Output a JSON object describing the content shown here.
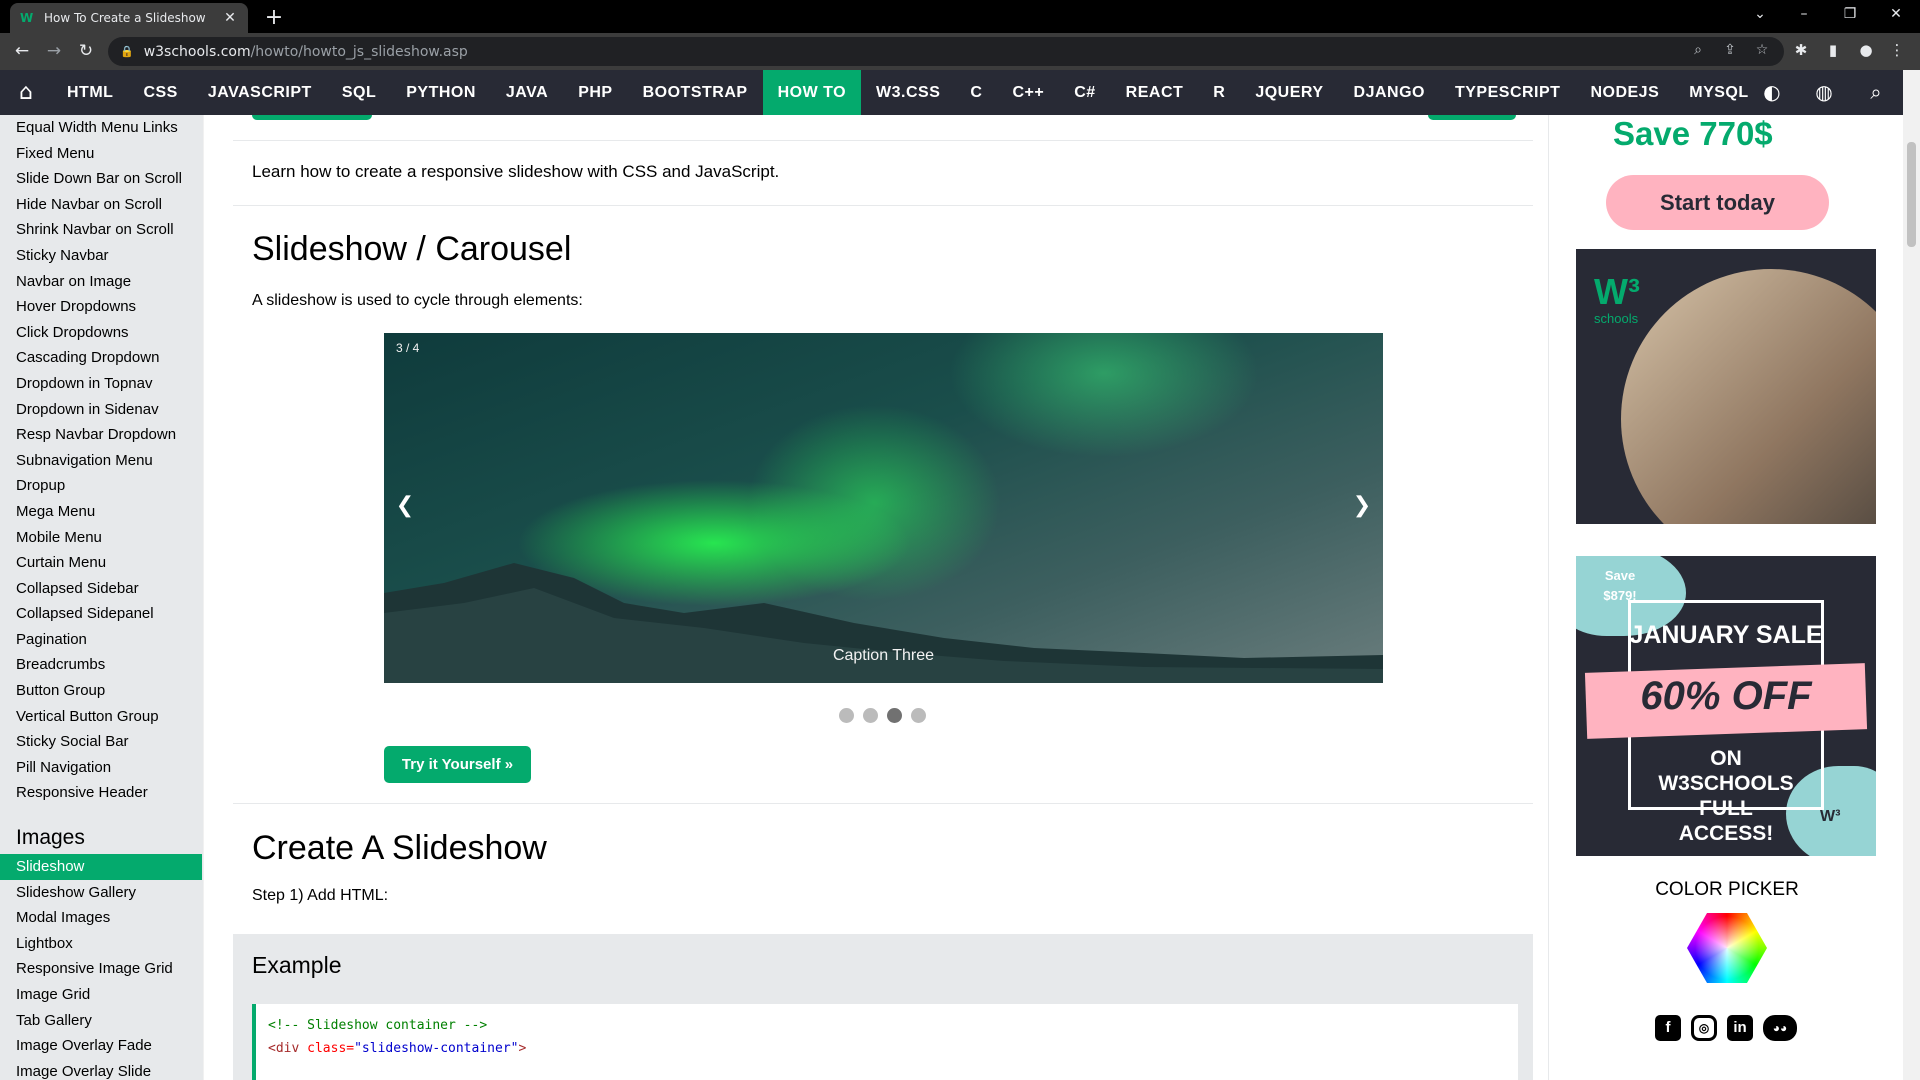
{
  "browser": {
    "tab_title": "How To Create a Slideshow",
    "favicon": "W",
    "url_domain": "w3schools.com",
    "url_path": "/howto/howto_js_slideshow.asp"
  },
  "topnav": {
    "items": [
      "HTML",
      "CSS",
      "JAVASCRIPT",
      "SQL",
      "PYTHON",
      "JAVA",
      "PHP",
      "BOOTSTRAP",
      "HOW TO",
      "W3.CSS",
      "C",
      "C++",
      "C#",
      "REACT",
      "R",
      "JQUERY",
      "DJANGO",
      "TYPESCRIPT",
      "NODEJS",
      "MYSQL"
    ],
    "active": "HOW TO"
  },
  "sidebar": {
    "links": [
      "Equal Width Menu Links",
      "Fixed Menu",
      "Slide Down Bar on Scroll",
      "Hide Navbar on Scroll",
      "Shrink Navbar on Scroll",
      "Sticky Navbar",
      "Navbar on Image",
      "Hover Dropdowns",
      "Click Dropdowns",
      "Cascading Dropdown",
      "Dropdown in Topnav",
      "Dropdown in Sidenav",
      "Resp Navbar Dropdown",
      "Subnavigation Menu",
      "Dropup",
      "Mega Menu",
      "Mobile Menu",
      "Curtain Menu",
      "Collapsed Sidebar",
      "Collapsed Sidepanel",
      "Pagination",
      "Breadcrumbs",
      "Button Group",
      "Vertical Button Group",
      "Sticky Social Bar",
      "Pill Navigation",
      "Responsive Header"
    ],
    "heading": "Images",
    "image_links": [
      "Slideshow",
      "Slideshow Gallery",
      "Modal Images",
      "Lightbox",
      "Responsive Image Grid",
      "Image Grid",
      "Tab Gallery",
      "Image Overlay Fade",
      "Image Overlay Slide"
    ],
    "active": "Slideshow"
  },
  "main": {
    "intro": "Learn how to create a responsive slideshow with CSS and JavaScript.",
    "section1_title": "Slideshow / Carousel",
    "section1_text": "A slideshow is used to cycle through elements:",
    "slide_number": "3 / 4",
    "slide_caption": "Caption Three",
    "prev_glyph": "❮",
    "next_glyph": "❯",
    "dots_total": 4,
    "dots_active": 3,
    "try_button": "Try it Yourself »",
    "section2_title": "Create A Slideshow",
    "step1": "Step 1) Add HTML:",
    "example_title": "Example",
    "code_line1": "<!-- Slideshow container -->",
    "code_line2_tag_open": "<div",
    "code_line2_attr": "class",
    "code_line2_eq": "=",
    "code_line2_val": "\"slideshow-container\"",
    "code_line2_tag_close": ">"
  },
  "right": {
    "save_text": "Save 770$",
    "start_button": "Start today",
    "ad1_logo": "W³",
    "ad1_logo_text": "schools",
    "ad2_save": "Save $879!",
    "ad2_title": "JANUARY SALE",
    "ad2_off": "60% OFF",
    "ad2_on": "ON W3SCHOOLS FULL ACCESS!",
    "ad2_logo": "W³",
    "color_picker": "COLOR PICKER",
    "social_icons": [
      "facebook-icon",
      "instagram-icon",
      "linkedin-icon",
      "discord-icon"
    ]
  },
  "colors": {
    "accent": "#04aa6d",
    "nav_bg": "#282a35",
    "sidebar_bg": "#e7e9eb",
    "pink": "#ffb3c0"
  }
}
